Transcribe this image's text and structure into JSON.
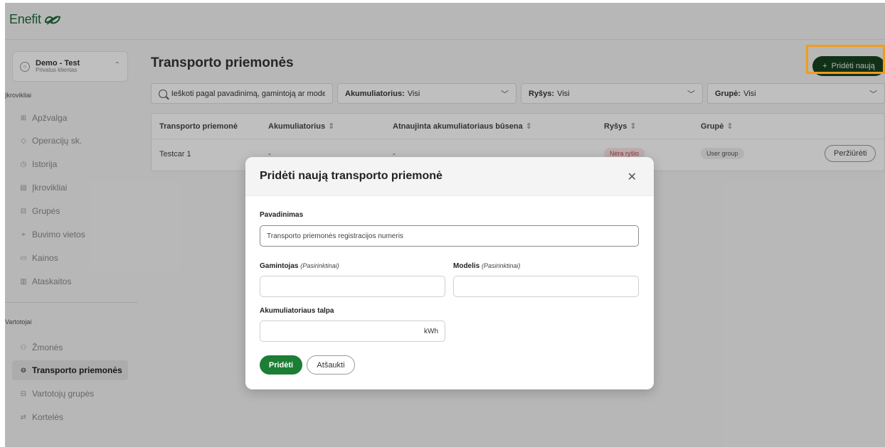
{
  "brand": {
    "logo_text": "Enefit",
    "logo_icon": "enefit-leaf-logo"
  },
  "account": {
    "name": "Demo - Test",
    "type": "Privatus klientas"
  },
  "sidebar": {
    "section1": "Įkrovikliai",
    "items1": [
      {
        "label": "Apžvalga",
        "icon": "grid-icon"
      },
      {
        "label": "Operacijų sk.",
        "icon": "diamond-icon"
      },
      {
        "label": "Istorija",
        "icon": "clock-icon"
      },
      {
        "label": "Įkrovikliai",
        "icon": "charger-icon"
      },
      {
        "label": "Grupės",
        "icon": "group-icon"
      },
      {
        "label": "Buvimo vietos",
        "icon": "location-icon"
      },
      {
        "label": "Kainos",
        "icon": "price-icon"
      },
      {
        "label": "Ataskaitos",
        "icon": "chart-icon"
      }
    ],
    "section2": "Vartotojai",
    "items2": [
      {
        "label": "Žmonės",
        "icon": "people-icon"
      },
      {
        "label": "Transporto priemonės",
        "icon": "car-icon",
        "active": true
      },
      {
        "label": "Vartotojų grupės",
        "icon": "user-group-icon"
      },
      {
        "label": "Kortelės",
        "icon": "card-icon"
      }
    ]
  },
  "main": {
    "title": "Transporto priemonės",
    "add_button": "Pridėti naują",
    "search_placeholder": "Ieškoti pagal pavadinimą, gamintoją ar modelį",
    "filters": [
      {
        "label": "Akumuliatorius:",
        "value": "Visi"
      },
      {
        "label": "Ryšys:",
        "value": "Visi"
      },
      {
        "label": "Grupė:",
        "value": "Visi"
      }
    ],
    "table": {
      "headers": [
        "Transporto priemonė",
        "Akumuliatorius",
        "Atnaujinta akumuliatoriaus būsena",
        "Ryšys",
        "Grupė"
      ],
      "row": {
        "name": "Testcar 1",
        "battery": "-",
        "updated": "-",
        "connection": "Nėra ryšio",
        "group": "User group",
        "action": "Peržiūrėti"
      }
    }
  },
  "modal": {
    "title": "Pridėti naują transporto priemonė",
    "name_label": "Pavadinimas",
    "name_placeholder": "Transporto priemonės registracijos numeris",
    "manufacturer_label": "Gamintojas",
    "model_label": "Modelis",
    "optional": "(Pasirinktinai)",
    "capacity_label": "Akumuliatoriaus talpa",
    "capacity_unit": "kWh",
    "submit": "Pridėti",
    "cancel": "Atšaukti"
  },
  "colors": {
    "brand_green": "#17421f",
    "primary_green": "#1c7d34",
    "highlight": "#f39b1c",
    "danger": "#c34a4a"
  }
}
